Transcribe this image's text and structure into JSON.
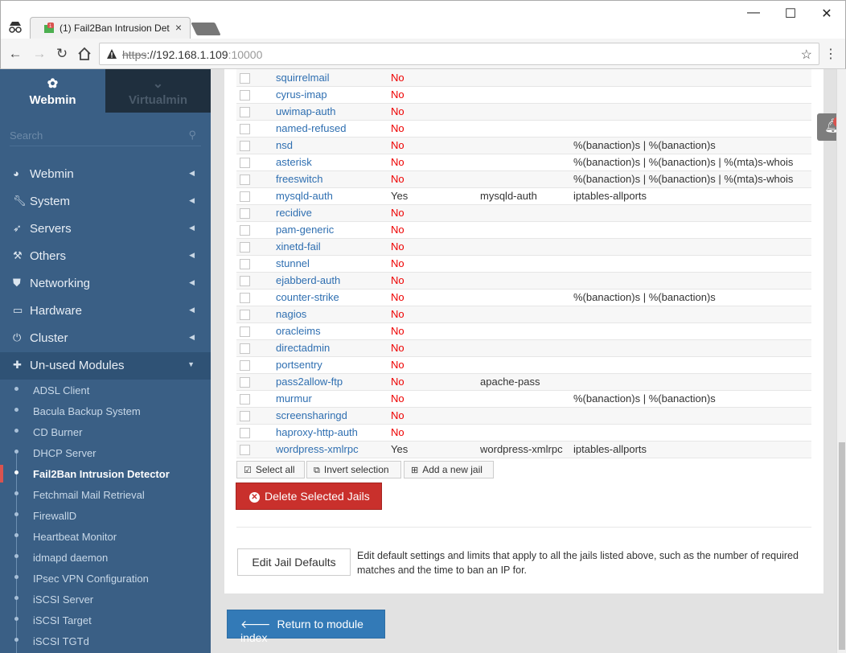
{
  "browser": {
    "tab_title": "(1) Fail2Ban Intrusion Det",
    "url_scheme": "https",
    "url_host": "://192.168.1.109",
    "url_port": ":10000",
    "minimize": "—",
    "maximize": "☐",
    "close": "✕"
  },
  "sidebar": {
    "brand_webmin": "Webmin",
    "brand_virtualmin": "Virtualmin",
    "search_placeholder": "Search",
    "categories": [
      {
        "label": "Webmin",
        "icon": "tachometer-icon"
      },
      {
        "label": "System",
        "icon": "wrench-icon"
      },
      {
        "label": "Servers",
        "icon": "rocket-icon"
      },
      {
        "label": "Others",
        "icon": "gavel-icon"
      },
      {
        "label": "Networking",
        "icon": "shield-icon"
      },
      {
        "label": "Hardware",
        "icon": "hdd-icon"
      },
      {
        "label": "Cluster",
        "icon": "power-icon"
      },
      {
        "label": "Un-used Modules",
        "icon": "puzzle-icon"
      }
    ],
    "modules": [
      "ADSL Client",
      "Bacula Backup System",
      "CD Burner",
      "DHCP Server",
      "Fail2Ban Intrusion Detector",
      "Fetchmail Mail Retrieval",
      "FirewallD",
      "Heartbeat Monitor",
      "idmapd daemon",
      "IPsec VPN Configuration",
      "iSCSI Server",
      "iSCSI Target",
      "iSCSI TGTd"
    ],
    "active_module": "Fail2Ban Intrusion Detector"
  },
  "jails": [
    {
      "name": "squirrelmail",
      "enabled": "No",
      "filter": "",
      "action": ""
    },
    {
      "name": "cyrus-imap",
      "enabled": "No",
      "filter": "",
      "action": ""
    },
    {
      "name": "uwimap-auth",
      "enabled": "No",
      "filter": "",
      "action": ""
    },
    {
      "name": "named-refused",
      "enabled": "No",
      "filter": "",
      "action": ""
    },
    {
      "name": "nsd",
      "enabled": "No",
      "filter": "",
      "action": "%(banaction)s | %(banaction)s"
    },
    {
      "name": "asterisk",
      "enabled": "No",
      "filter": "",
      "action": "%(banaction)s | %(banaction)s | %(mta)s-whois"
    },
    {
      "name": "freeswitch",
      "enabled": "No",
      "filter": "",
      "action": "%(banaction)s | %(banaction)s | %(mta)s-whois"
    },
    {
      "name": "mysqld-auth",
      "enabled": "Yes",
      "filter": "mysqld-auth",
      "action": "iptables-allports"
    },
    {
      "name": "recidive",
      "enabled": "No",
      "filter": "",
      "action": ""
    },
    {
      "name": "pam-generic",
      "enabled": "No",
      "filter": "",
      "action": ""
    },
    {
      "name": "xinetd-fail",
      "enabled": "No",
      "filter": "",
      "action": ""
    },
    {
      "name": "stunnel",
      "enabled": "No",
      "filter": "",
      "action": ""
    },
    {
      "name": "ejabberd-auth",
      "enabled": "No",
      "filter": "",
      "action": ""
    },
    {
      "name": "counter-strike",
      "enabled": "No",
      "filter": "",
      "action": "%(banaction)s | %(banaction)s"
    },
    {
      "name": "nagios",
      "enabled": "No",
      "filter": "",
      "action": ""
    },
    {
      "name": "oracleims",
      "enabled": "No",
      "filter": "",
      "action": ""
    },
    {
      "name": "directadmin",
      "enabled": "No",
      "filter": "",
      "action": ""
    },
    {
      "name": "portsentry",
      "enabled": "No",
      "filter": "",
      "action": ""
    },
    {
      "name": "pass2allow-ftp",
      "enabled": "No",
      "filter": "apache-pass",
      "action": ""
    },
    {
      "name": "murmur",
      "enabled": "No",
      "filter": "",
      "action": "%(banaction)s | %(banaction)s"
    },
    {
      "name": "screensharingd",
      "enabled": "No",
      "filter": "",
      "action": ""
    },
    {
      "name": "haproxy-http-auth",
      "enabled": "No",
      "filter": "",
      "action": ""
    },
    {
      "name": "wordpress-xmlrpc",
      "enabled": "Yes",
      "filter": "wordpress-xmlrpc",
      "action": "iptables-allports"
    }
  ],
  "actions": {
    "select_all": "Select all",
    "invert_selection": "Invert selection",
    "add_jail": "Add a new jail",
    "delete_selected": "Delete Selected Jails",
    "edit_defaults": "Edit Jail Defaults",
    "edit_defaults_desc": "Edit default settings and limits that apply to all the jails listed above, such as the number of required matches and the time to ban an IP for.",
    "return_index": "Return to module index"
  },
  "notifications": {
    "count": "1"
  }
}
